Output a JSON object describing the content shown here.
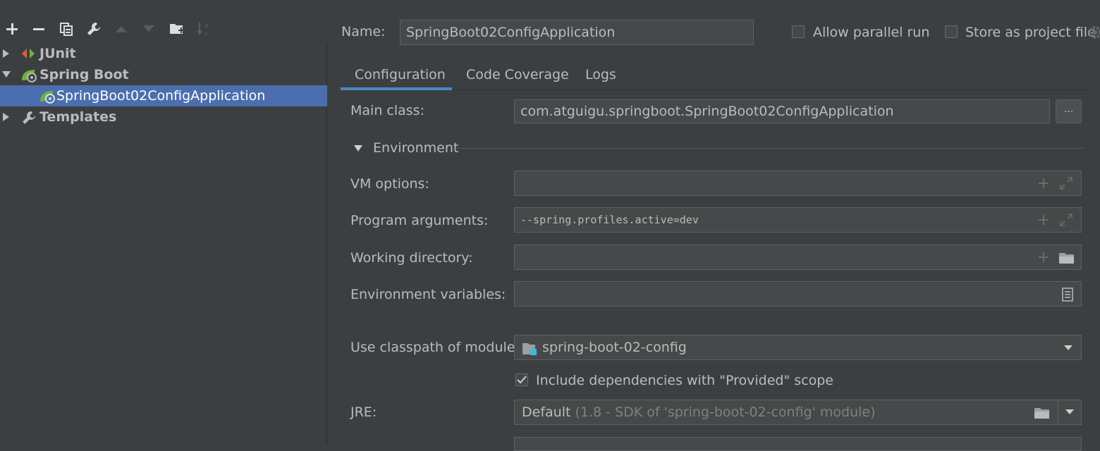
{
  "toolbar": {
    "icons": [
      "plus-icon",
      "minus-icon",
      "copy-icon",
      "wrench-icon",
      "arrow-up-icon",
      "arrow-down-icon",
      "folder-add-icon",
      "sort-alpha-icon"
    ]
  },
  "tree": {
    "items": [
      {
        "label": "JUnit",
        "icon": "junit-icon",
        "expanded": false
      },
      {
        "label": "Spring Boot",
        "icon": "spring-boot-icon",
        "expanded": true
      },
      {
        "label": "SpringBoot02ConfigApplication",
        "icon": "spring-boot-app-icon",
        "selected": true
      },
      {
        "label": "Templates",
        "icon": "wrench-icon",
        "expanded": false
      }
    ]
  },
  "header": {
    "name_label": "Name:",
    "name_value": "SpringBoot02ConfigApplication",
    "allow_parallel_label": "Allow parallel run",
    "allow_parallel_checked": false,
    "store_project_label": "Store as project file",
    "store_project_checked": false
  },
  "tabs": [
    {
      "label": "Configuration",
      "active": true
    },
    {
      "label": "Code Coverage",
      "active": false
    },
    {
      "label": "Logs",
      "active": false
    }
  ],
  "config": {
    "main_class_label": "Main class:",
    "main_class_value": "com.atguigu.springboot.SpringBoot02ConfigApplication",
    "browse_label": "...",
    "environment_label": "Environment",
    "vm_options_label": "VM options:",
    "vm_options_value": "",
    "program_args_label": "Program arguments:",
    "program_args_value": "--spring.profiles.active=dev",
    "working_dir_label": "Working directory:",
    "working_dir_value": "",
    "env_vars_label": "Environment variables:",
    "env_vars_value": "",
    "classpath_label": "Use classpath of module:",
    "classpath_value": "spring-boot-02-config",
    "include_deps_label": "Include dependencies with \"Provided\" scope",
    "include_deps_checked": true,
    "jre_label": "JRE:",
    "jre_value": "Default",
    "jre_detail": "(1.8 - SDK of 'spring-boot-02-config' module)"
  },
  "colors": {
    "background": "#3c3f41",
    "selection": "#4b6eaf",
    "accent": "#4a88c7",
    "field": "#45494a",
    "spring_green": "#6db33f",
    "junit_orange": "#e0602a"
  }
}
